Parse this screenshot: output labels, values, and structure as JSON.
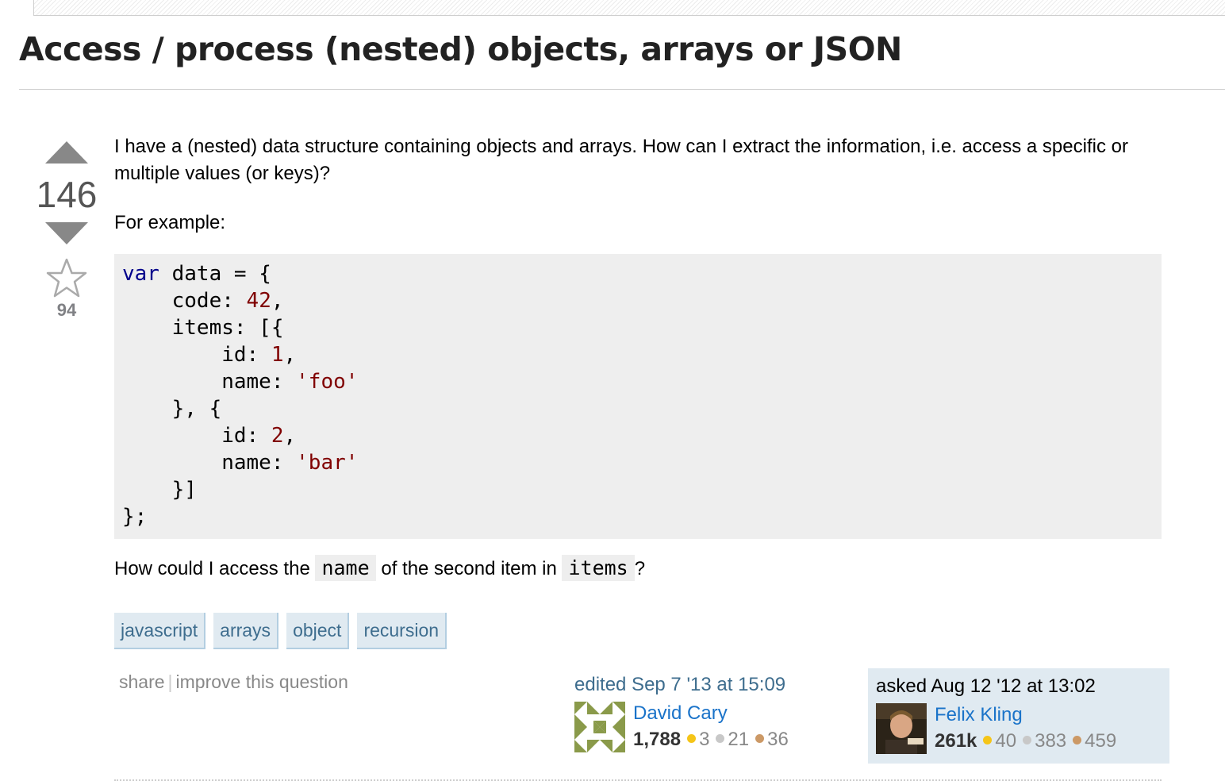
{
  "question": {
    "title": "Access / process (nested) objects, arrays or JSON",
    "votes": "146",
    "favorites": "94",
    "body": {
      "intro": "I have a (nested) data structure containing objects and arrays. How can I extract the information, i.e. access a specific or multiple values (or keys)?",
      "example_label": "For example:",
      "code_lines": {
        "l1_kw": "var",
        "l1_rest": " data = {",
        "l2_key": "    code: ",
        "l2_val": "42",
        "l2_end": ",",
        "l3": "    items: [{",
        "l4_key": "        id: ",
        "l4_val": "1",
        "l4_end": ",",
        "l5_key": "        name: ",
        "l5_val": "'foo'",
        "l6": "    }, {",
        "l7_key": "        id: ",
        "l7_val": "2",
        "l7_end": ",",
        "l8_key": "        name: ",
        "l8_val": "'bar'",
        "l9": "    }]",
        "l10": "};"
      },
      "question_parts": {
        "p1": "How could I access the ",
        "code1": "name",
        "p2": " of the second item in ",
        "code2": "items",
        "p3": "?"
      }
    },
    "tags": [
      "javascript",
      "arrays",
      "object",
      "recursion"
    ],
    "menu": {
      "share": "share",
      "separator": "|",
      "improve": "improve this question"
    },
    "edited": {
      "action": "edited Sep 7 '13 at 15:09",
      "user": "David Cary",
      "reputation": "1,788",
      "gold": "3",
      "silver": "21",
      "bronze": "36"
    },
    "asked": {
      "action": "asked Aug 12 '12 at 13:02",
      "user": "Felix Kling",
      "reputation": "261k",
      "gold": "40",
      "silver": "383",
      "bronze": "459"
    }
  },
  "colors": {
    "link": "#3e6d8e",
    "tag_bg": "#e0eaf1",
    "code_bg": "#eeeeee",
    "owner_bg": "#e0eaf1"
  },
  "icons": {
    "upvote": "upvote-arrow-icon",
    "downvote": "downvote-arrow-icon",
    "favorite": "star-icon"
  }
}
